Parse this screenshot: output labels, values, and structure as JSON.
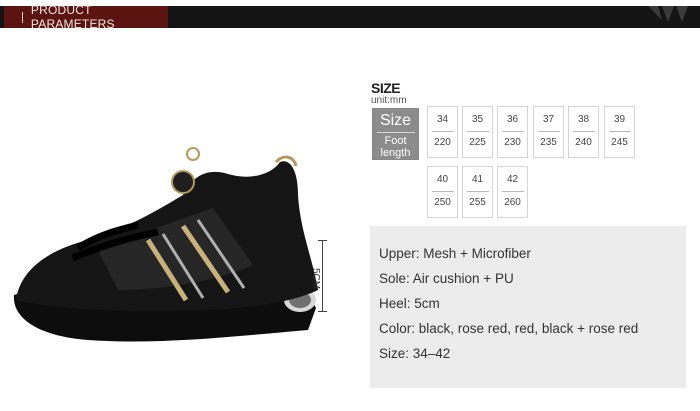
{
  "header": {
    "title": "PRODUCT PARAMETERS"
  },
  "size_chart": {
    "title": "SIZE",
    "unit": "unit:mm",
    "header_size": "Size",
    "header_length": "Foot length",
    "row1": [
      {
        "size": "34",
        "length": "220"
      },
      {
        "size": "35",
        "length": "225"
      },
      {
        "size": "36",
        "length": "230"
      },
      {
        "size": "37",
        "length": "235"
      },
      {
        "size": "38",
        "length": "240"
      },
      {
        "size": "39",
        "length": "245"
      }
    ],
    "row2": [
      {
        "size": "40",
        "length": "250"
      },
      {
        "size": "41",
        "length": "255"
      },
      {
        "size": "42",
        "length": "260"
      }
    ]
  },
  "measure": {
    "label": "5CM"
  },
  "specs": [
    "Upper: Mesh + Microfiber",
    "Sole: Air cushion + PU",
    "Heel: 5cm",
    "Color: black, rose red, red, black + rose red",
    "Size: 34–42"
  ],
  "colors": {
    "header_bar": "#141414",
    "header_tag": "#5c1411",
    "specs_bg": "#ececec",
    "size_head": "#8c8c8c"
  }
}
